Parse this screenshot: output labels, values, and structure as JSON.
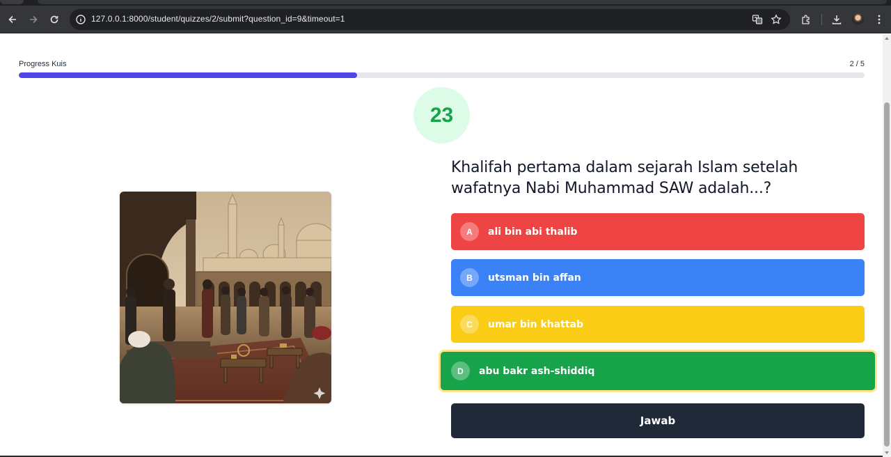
{
  "browser": {
    "url": "127.0.0.1:8000/student/quizzes/2/submit?question_id=9&timeout=1"
  },
  "quiz": {
    "progress_label": "Progress Kuis",
    "progress_count": "2 / 5",
    "progress_fraction": 0.4,
    "timer": "23",
    "question": "Khalifah pertama dalam sejarah Islam setelah wafatnya Nabi Muhammad SAW adalah...?",
    "options": [
      {
        "letter": "A",
        "text": "ali bin abi thalib",
        "color": "#ef4444"
      },
      {
        "letter": "B",
        "text": "utsman bin affan",
        "color": "#3b82f6"
      },
      {
        "letter": "C",
        "text": "umar bin khattab",
        "color": "#facc15"
      },
      {
        "letter": "D",
        "text": "abu bakr ash-shiddiq",
        "color": "#16a34a",
        "selected": true
      }
    ],
    "submit_label": "Jawab"
  },
  "colors": {
    "progress_fill": "#4f46e5",
    "timer_bg": "#dcfce7",
    "timer_text": "#16a34a",
    "submit_bg": "#1f2937",
    "selected_ring": "#fde68a"
  }
}
